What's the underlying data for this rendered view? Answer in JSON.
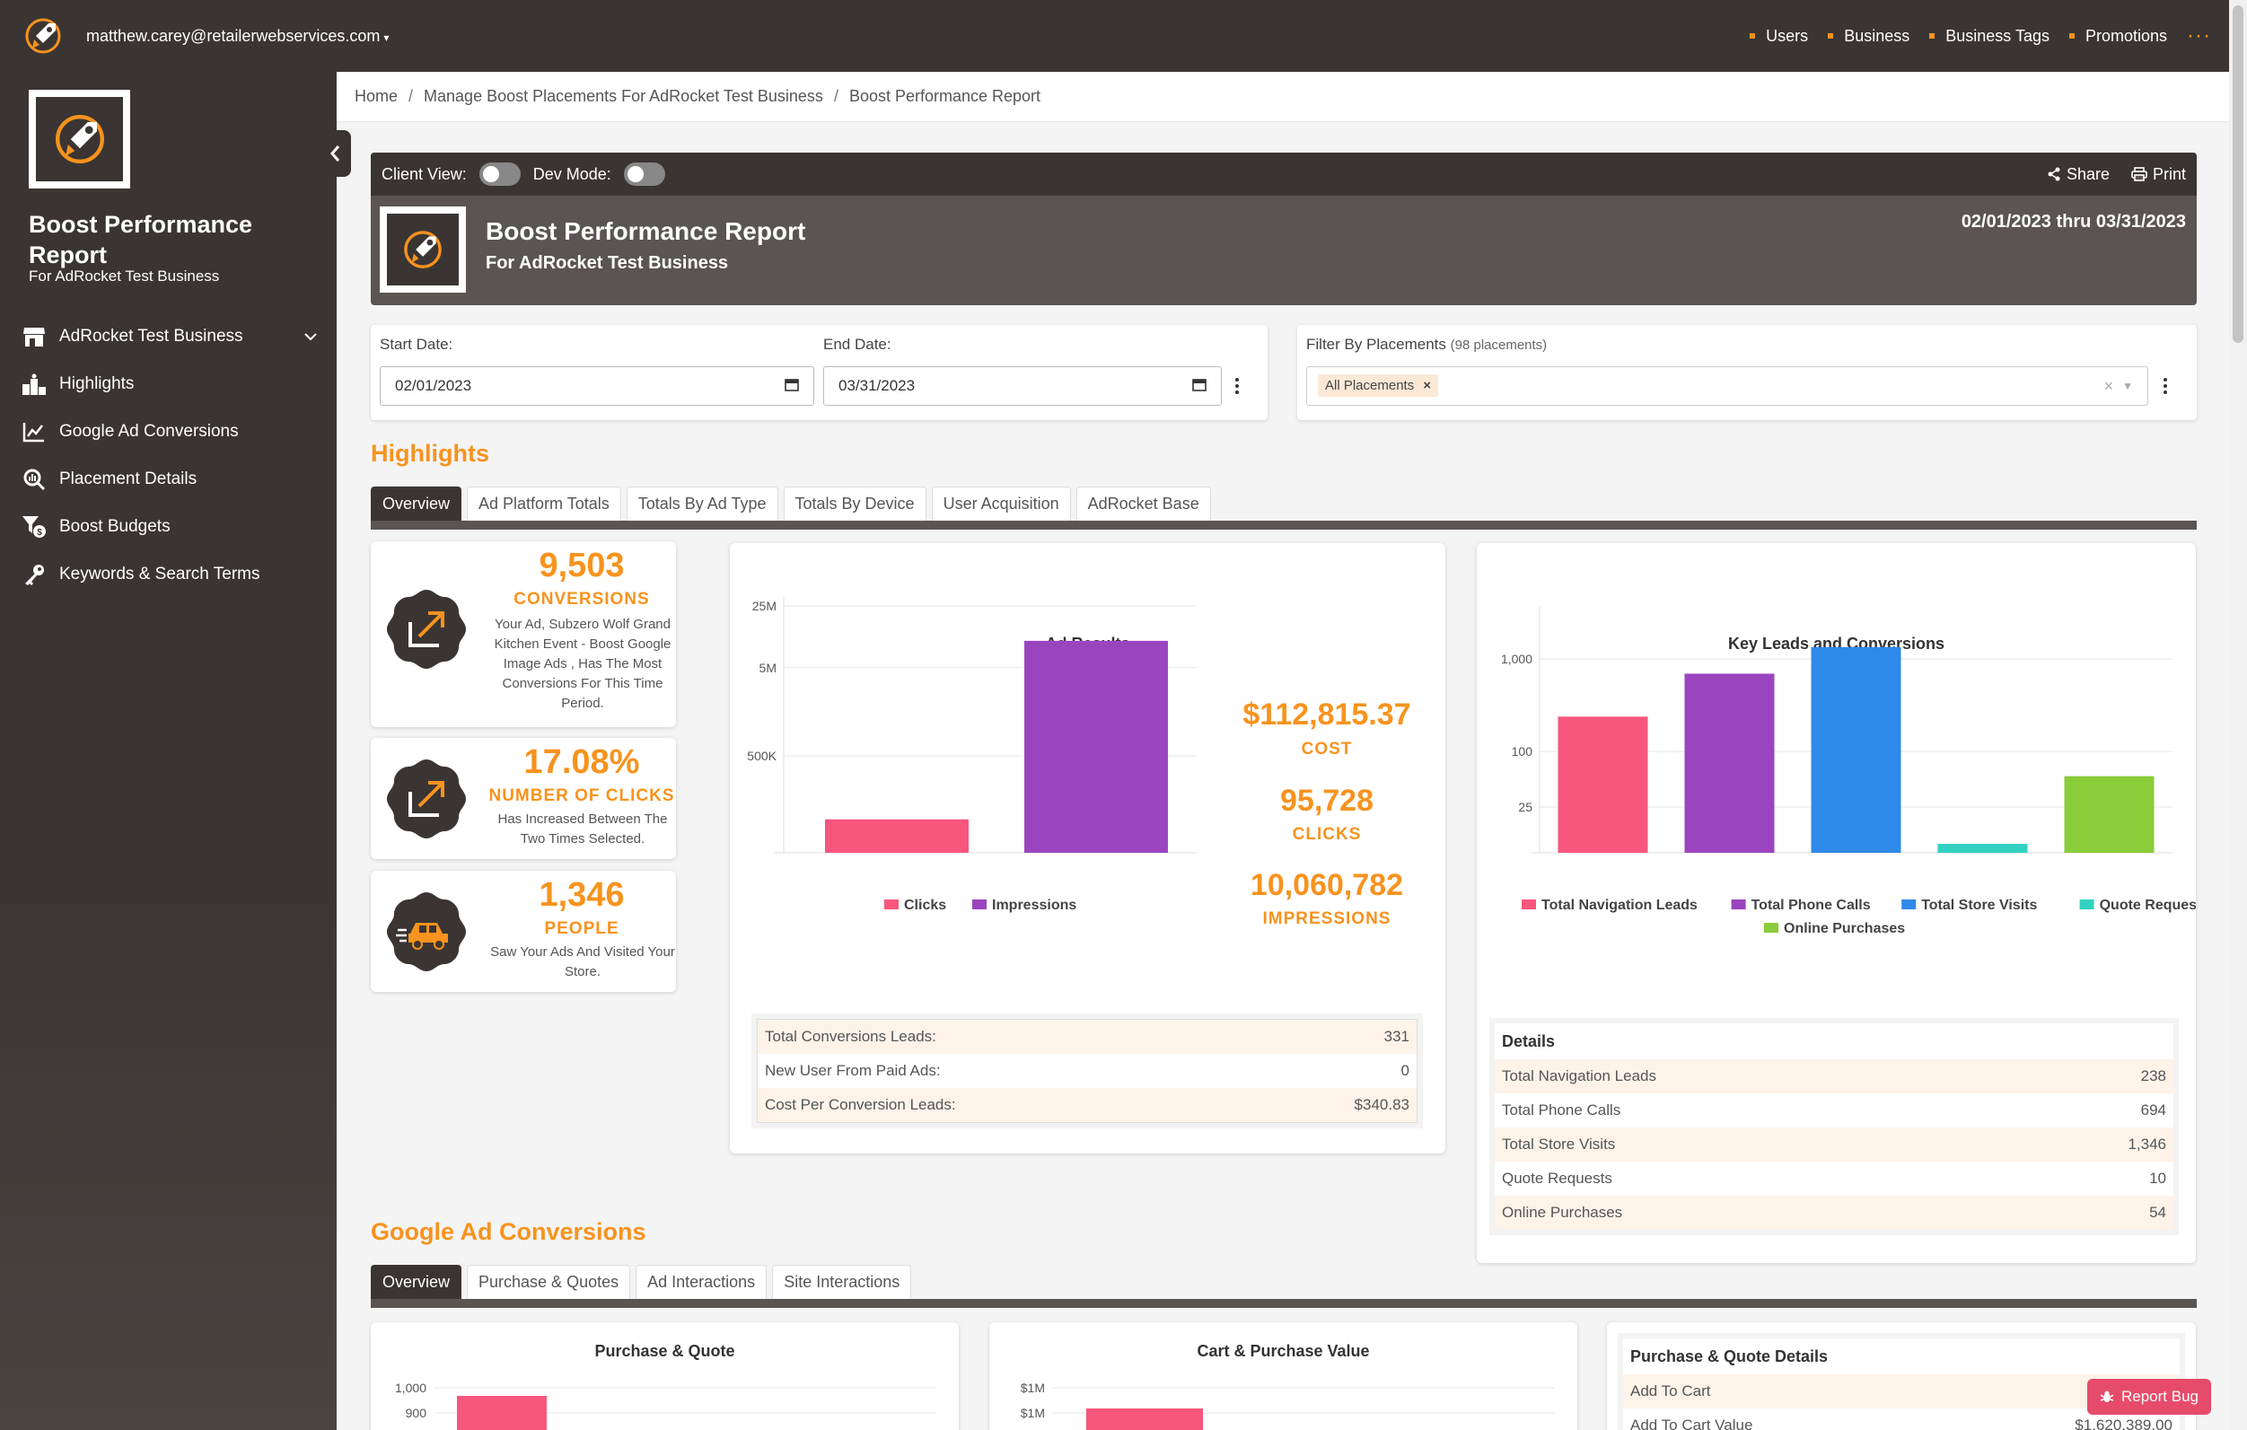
{
  "topbar": {
    "user_email": "matthew.carey@retailerwebservices.com",
    "nav": [
      "Users",
      "Business",
      "Business Tags",
      "Promotions"
    ],
    "more": "···"
  },
  "sidebar": {
    "title": "Boost Performance Report",
    "subtitle": "For AdRocket Test Business",
    "items": [
      {
        "label": "AdRocket Test Business",
        "icon": "store-icon"
      },
      {
        "label": "Highlights",
        "icon": "podium-icon"
      },
      {
        "label": "Google Ad Conversions",
        "icon": "line-chart-icon"
      },
      {
        "label": "Placement Details",
        "icon": "search-chart-icon"
      },
      {
        "label": "Boost Budgets",
        "icon": "filter-dollar-icon"
      },
      {
        "label": "Keywords & Search Terms",
        "icon": "key-icon"
      }
    ]
  },
  "breadcrumb": [
    "Home",
    "Manage Boost Placements For AdRocket Test Business",
    "Boost Performance Report"
  ],
  "report_header": {
    "client_view_label": "Client View:",
    "dev_mode_label": "Dev Mode:",
    "share_label": "Share",
    "print_label": "Print",
    "title": "Boost Performance Report",
    "subtitle": "For AdRocket Test Business",
    "date_range": "02/01/2023 thru 03/31/2023"
  },
  "filters": {
    "start_label": "Start Date:",
    "start_value": "02/01/2023",
    "end_label": "End Date:",
    "end_value": "03/31/2023",
    "placements_label": "Filter By Placements",
    "placements_count": "(98 placements)",
    "placements_chip": "All Placements",
    "chip_remove": "×",
    "clear": "×"
  },
  "highlights": {
    "title": "Highlights",
    "tabs": [
      "Overview",
      "Ad Platform Totals",
      "Totals By Ad Type",
      "Totals By Device",
      "User Acquisition",
      "AdRocket Base"
    ],
    "cards": [
      {
        "value": "9,503",
        "caption": "CONVERSIONS",
        "desc": "Your Ad, Subzero Wolf Grand Kitchen Event - Boost Google Image Ads , Has The Most Conversions For This Time Period.",
        "icon": "trend-up-icon"
      },
      {
        "value": "17.08%",
        "caption": "NUMBER OF CLICKS",
        "desc": "Has Increased Between The Two Times Selected.",
        "icon": "trend-up-icon"
      },
      {
        "value": "1,346",
        "caption": "PEOPLE",
        "desc": "Saw Your Ads And Visited Your Store.",
        "icon": "car-icon"
      }
    ]
  },
  "ad_results": {
    "title": "Ad Results",
    "stats": [
      {
        "value": "$112,815.37",
        "caption": "COST"
      },
      {
        "value": "95,728",
        "caption": "CLICKS"
      },
      {
        "value": "10,060,782",
        "caption": "IMPRESSIONS"
      }
    ],
    "table": [
      {
        "label": "Total Conversions Leads:",
        "value": "331"
      },
      {
        "label": "New User From Paid Ads:",
        "value": "0"
      },
      {
        "label": "Cost Per Conversion Leads:",
        "value": "$340.83"
      }
    ]
  },
  "key_leads": {
    "title": "Key Leads and Conversions",
    "details_title": "Details",
    "rows": [
      {
        "label": "Total Navigation Leads",
        "value": "238"
      },
      {
        "label": "Total Phone Calls",
        "value": "694"
      },
      {
        "label": "Total Store Visits",
        "value": "1,346"
      },
      {
        "label": "Quote Requests",
        "value": "10"
      },
      {
        "label": "Online Purchases",
        "value": "54"
      }
    ]
  },
  "google_ad": {
    "title": "Google Ad Conversions",
    "tabs": [
      "Overview",
      "Purchase & Quotes",
      "Ad Interactions",
      "Site Interactions"
    ],
    "purchase_quote_title": "Purchase & Quote",
    "cart_value_title": "Cart & Purchase Value",
    "details_title": "Purchase & Quote Details",
    "details_rows": [
      {
        "label": "Add To Cart",
        "value": ""
      },
      {
        "label": "Add To Cart Value",
        "value": "$1,620,389.00"
      }
    ]
  },
  "report_bug": "Report Bug",
  "colors": {
    "accent": "#f7931e",
    "dark": "#3a3533",
    "pink": "#f7577d",
    "purple": "#9b44bf",
    "blue": "#2f89e8",
    "teal": "#33d1c2",
    "green": "#8bcc3a"
  },
  "chart_data": [
    {
      "type": "bar",
      "title": "Ad Results",
      "categories": [
        "Clicks",
        "Impressions"
      ],
      "series": [
        {
          "name": "Clicks",
          "values": [
            95728,
            null
          ]
        },
        {
          "name": "Impressions",
          "values": [
            null,
            10060782
          ]
        }
      ],
      "yscale": "log",
      "yticks": [
        "25M",
        "5M",
        "500K"
      ],
      "legend": "bottom"
    },
    {
      "type": "bar",
      "title": "Key Leads and Conversions",
      "categories": [
        "Total Navigation Leads",
        "Total Phone Calls",
        "Total Store Visits",
        "Quote Requests",
        "Online Purchases"
      ],
      "values": [
        238,
        694,
        1346,
        10,
        54
      ],
      "yscale": "log",
      "yticks": [
        "1,000",
        "100",
        "25"
      ],
      "legend": "bottom"
    },
    {
      "type": "bar",
      "title": "Purchase & Quote",
      "yticks": [
        "1,000",
        "900"
      ]
    },
    {
      "type": "bar",
      "title": "Cart & Purchase Value",
      "yticks": [
        "$1M",
        "$1M"
      ]
    }
  ]
}
